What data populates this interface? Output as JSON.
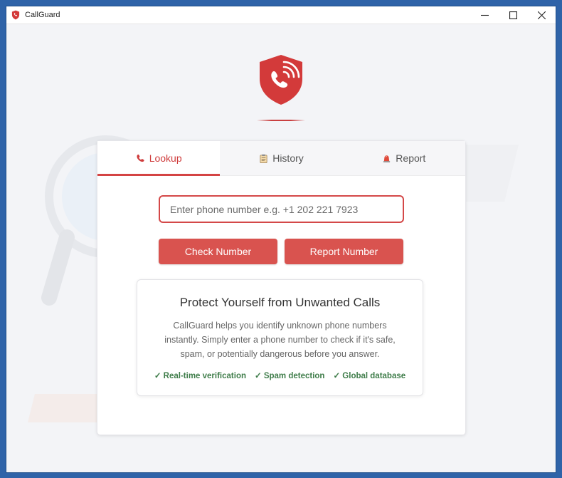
{
  "window": {
    "title": "CallGuard",
    "controls": [
      "minimize-icon",
      "maximize-icon",
      "close-icon"
    ]
  },
  "brand": {
    "accent": "#d9534f",
    "accent_dark": "#c8342f"
  },
  "tabs": [
    {
      "label": "Lookup",
      "icon": "phone-icon",
      "active": true
    },
    {
      "label": "History",
      "icon": "clipboard-icon",
      "active": false
    },
    {
      "label": "Report",
      "icon": "alert-bell-icon",
      "active": false
    }
  ],
  "lookup": {
    "placeholder": "Enter phone number e.g. +1 202 221 7923",
    "value": "",
    "check_button": "Check Number",
    "report_button": "Report Number"
  },
  "info": {
    "title": "Protect Yourself from Unwanted Calls",
    "body": "CallGuard helps you identify unknown phone numbers instantly. Simply enter a phone number to check if it's safe, spam, or potentially dangerous before you answer.",
    "features": [
      "✓ Real-time verification",
      "✓ Spam detection",
      "✓ Global database"
    ]
  }
}
